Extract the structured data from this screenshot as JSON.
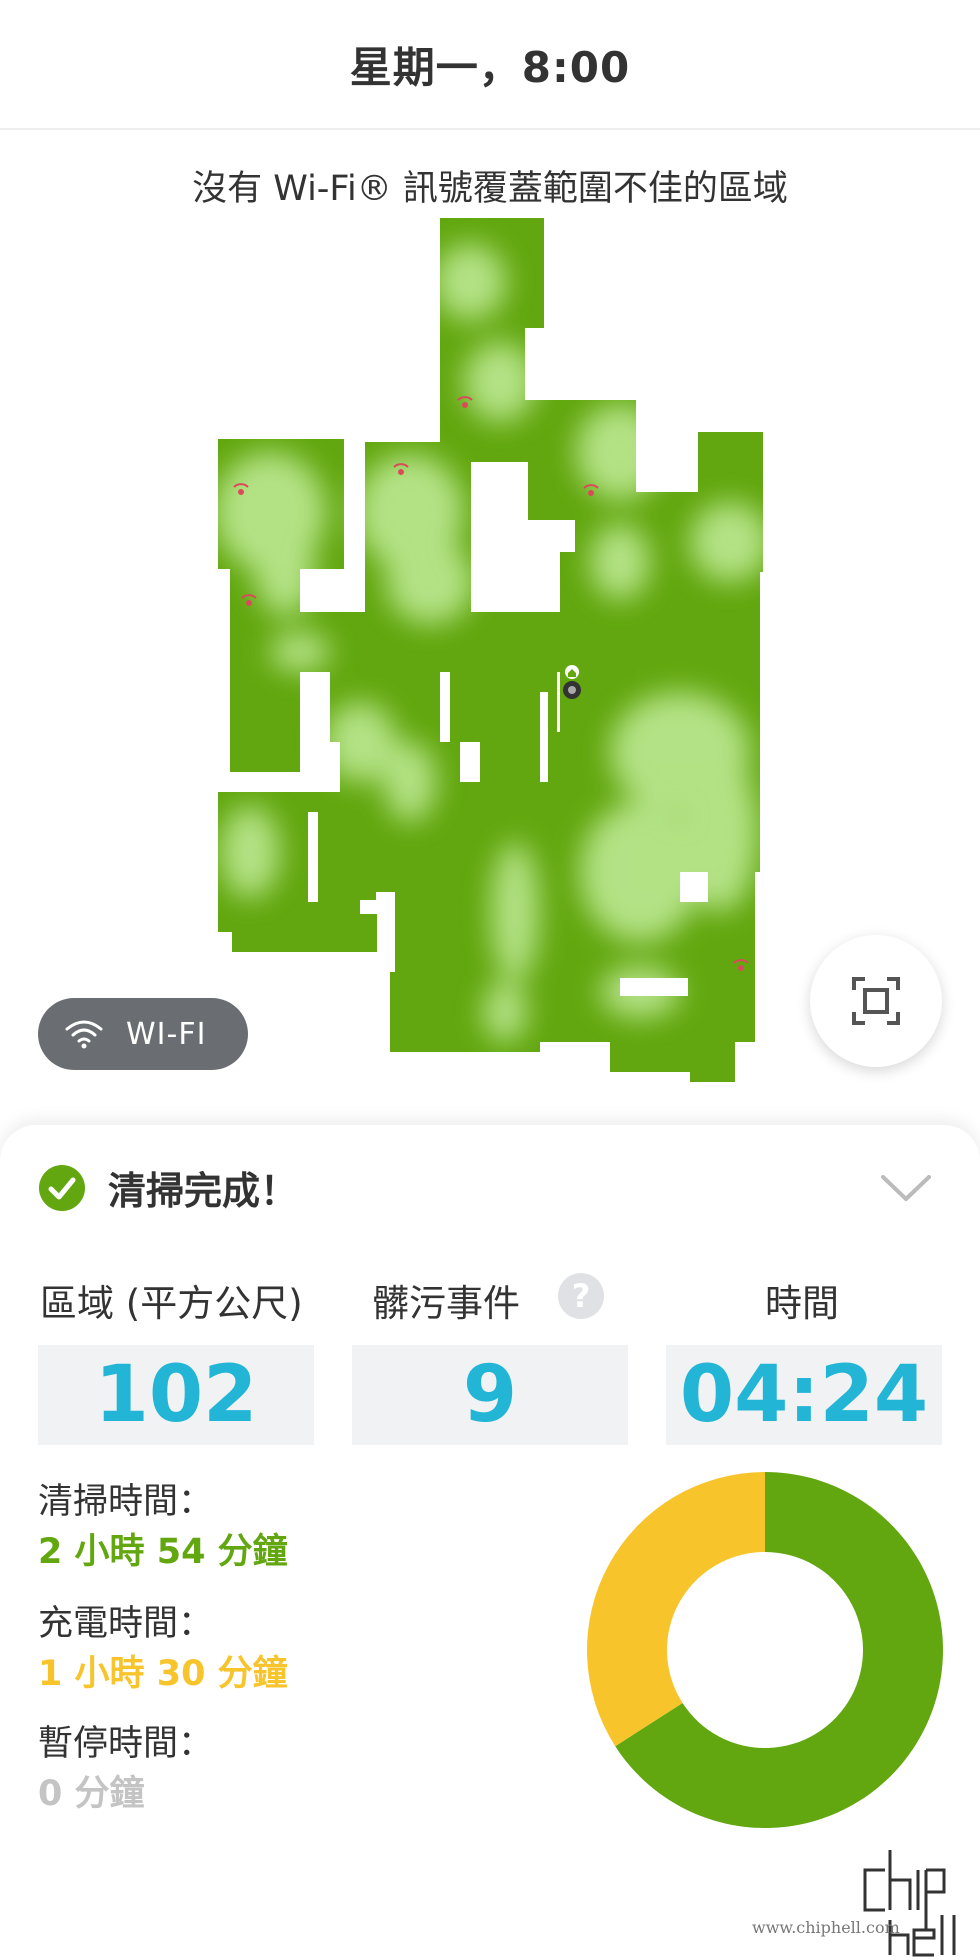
{
  "header": {
    "title": "星期一，8:00"
  },
  "map": {
    "subtitle": "沒有 Wi-Fi® 訊號覆蓋範圍不佳的區域",
    "icons": [
      "home-icon",
      "robot-icon",
      "weak-wifi-icon"
    ]
  },
  "wifi_toggle": {
    "label": "WI-FI",
    "icon": "wifi-icon"
  },
  "focus_button": {
    "icon": "focus-frame-icon"
  },
  "status": {
    "title": "清掃完成！",
    "icon": "check-circle-icon"
  },
  "stats": {
    "area_label": "區域 (平方公尺)",
    "area_value": "102",
    "dirt_label": "髒污事件",
    "dirt_value": "9",
    "time_label": "時間",
    "time_value": "04:24"
  },
  "details": {
    "clean_label": "清掃時間：",
    "clean_value": "2 小時 54 分鐘",
    "charge_label": "充電時間：",
    "charge_value": "1 小時 30 分鐘",
    "pause_label": "暫停時間：",
    "pause_value": "0 分鐘"
  },
  "time_breakdown_minutes": {
    "cleaning": 174,
    "charging": 90,
    "paused": 0
  },
  "colors": {
    "green": "#62a70f",
    "light_green": "#b8e58c",
    "yellow": "#f7c52b",
    "grey": "#c4c4c4",
    "accent_blue": "#22b5d6",
    "wifi_pill": "#6a6d71"
  },
  "watermark": {
    "text": "chip hell",
    "url": "www.chiphell.com"
  }
}
